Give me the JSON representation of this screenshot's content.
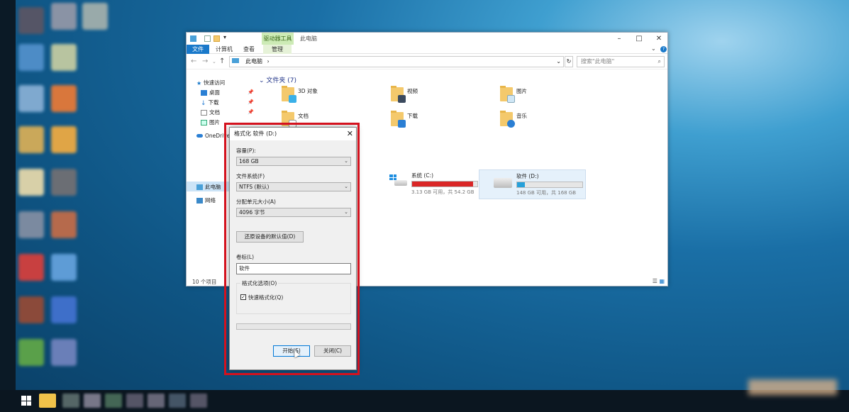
{
  "explorer": {
    "title": "此电脑",
    "context_group": "驱动器工具",
    "tabs": [
      "文件",
      "计算机",
      "查看",
      "管理"
    ],
    "address_path": "此电脑",
    "search_placeholder": "搜索\"此电脑\"",
    "nav": {
      "quick_access": "快速访问",
      "desktop": "桌面",
      "downloads": "下载",
      "documents": "文档",
      "pictures": "图片",
      "onedrive": "OneDrive",
      "this_pc": "此电脑",
      "network": "网络"
    },
    "folders_header": "文件夹 (7)",
    "folders": [
      "3D 对象",
      "视频",
      "图片",
      "文档",
      "下载",
      "音乐"
    ],
    "drives": [
      {
        "name": "系统 (C:)",
        "free": "3.13 GB 可用，共 54.2 GB",
        "used_fraction": 0.94,
        "bar_color": "#da2626"
      },
      {
        "name": "软件 (D:)",
        "free": "148 GB 可用，共 168 GB",
        "used_fraction": 0.12,
        "bar_color": "#26a0da"
      }
    ],
    "status": "10 个项目"
  },
  "dialog": {
    "title": "格式化 软件 (D:)",
    "capacity_label": "容量(P):",
    "capacity_value": "168 GB",
    "fs_label": "文件系统(F)",
    "fs_value": "NTFS (默认)",
    "alloc_label": "分配单元大小(A)",
    "alloc_value": "4096 字节",
    "restore_button": "还原设备的默认值(D)",
    "volume_label": "卷标(L)",
    "volume_value": "软件",
    "options_legend": "格式化选项(O)",
    "quick_format_label": "快速格式化(Q)",
    "quick_format_checked": true,
    "start_button": "开始(S)",
    "close_button": "关闭(C)"
  },
  "colors": {
    "highlight": "#d4121e",
    "file_tab": "#1979ca",
    "context_tab": "#cdebb6"
  }
}
